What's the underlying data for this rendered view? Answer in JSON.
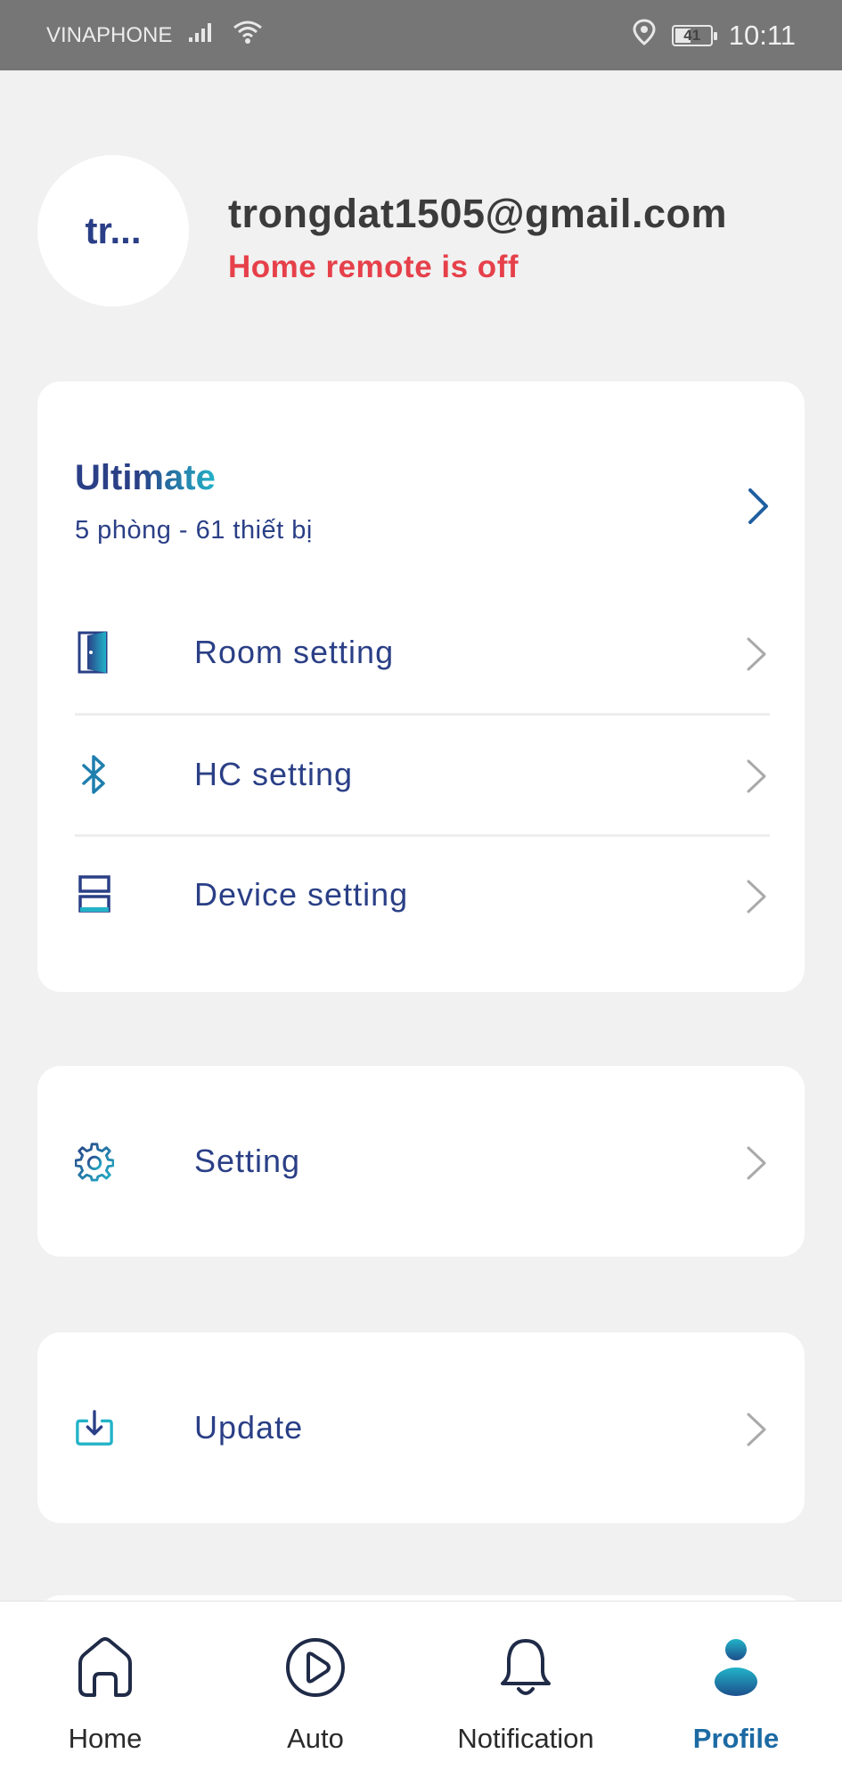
{
  "status_bar": {
    "carrier": "VINAPHONE",
    "battery": "41",
    "time": "10:11"
  },
  "profile": {
    "avatar_text": "tr...",
    "email": "trongdat1505@gmail.com",
    "remote_status": "Home remote is off"
  },
  "plan": {
    "name": "Ultimate",
    "description": "5 phòng - 61 thiết bị"
  },
  "menu": {
    "room_setting": "Room setting",
    "hc_setting": "HC setting",
    "device_setting": "Device setting",
    "setting": "Setting",
    "update": "Update"
  },
  "bottom_nav": {
    "home": "Home",
    "auto": "Auto",
    "notification": "Notification",
    "profile": "Profile"
  },
  "colors": {
    "primary": "#2a3f86",
    "accent": "#22b3c8",
    "alert": "#e6404a",
    "active_tab": "#1c6aa3"
  }
}
